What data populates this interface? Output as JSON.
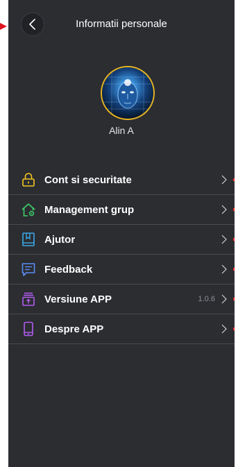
{
  "header": {
    "title": "Informatii personale",
    "back_icon": "chevron-left-icon"
  },
  "profile": {
    "name": "Alin A",
    "avatar_icon": "robot-face-avatar",
    "avatar_border_color": "#e6b422"
  },
  "menu": {
    "items": [
      {
        "label": "Cont si securitate",
        "icon": "lock-icon",
        "color": "#f3c623",
        "value": ""
      },
      {
        "label": "Management grup",
        "icon": "house-gear-icon",
        "color": "#3ecf6a",
        "value": ""
      },
      {
        "label": "Ajutor",
        "icon": "book-icon",
        "color": "#3aa9e8",
        "value": ""
      },
      {
        "label": "Feedback",
        "icon": "message-icon",
        "color": "#5b8df5",
        "value": ""
      },
      {
        "label": "Versiune APP",
        "icon": "upload-box-icon",
        "color": "#b25cf0",
        "value": "1.0.6"
      },
      {
        "label": "Despre APP",
        "icon": "phone-icon",
        "color": "#b25cf0",
        "value": ""
      }
    ]
  },
  "colors": {
    "background": "#2b2d31",
    "divider": "#4a4c51",
    "text": "#ffffff",
    "muted": "#8c8f94"
  }
}
